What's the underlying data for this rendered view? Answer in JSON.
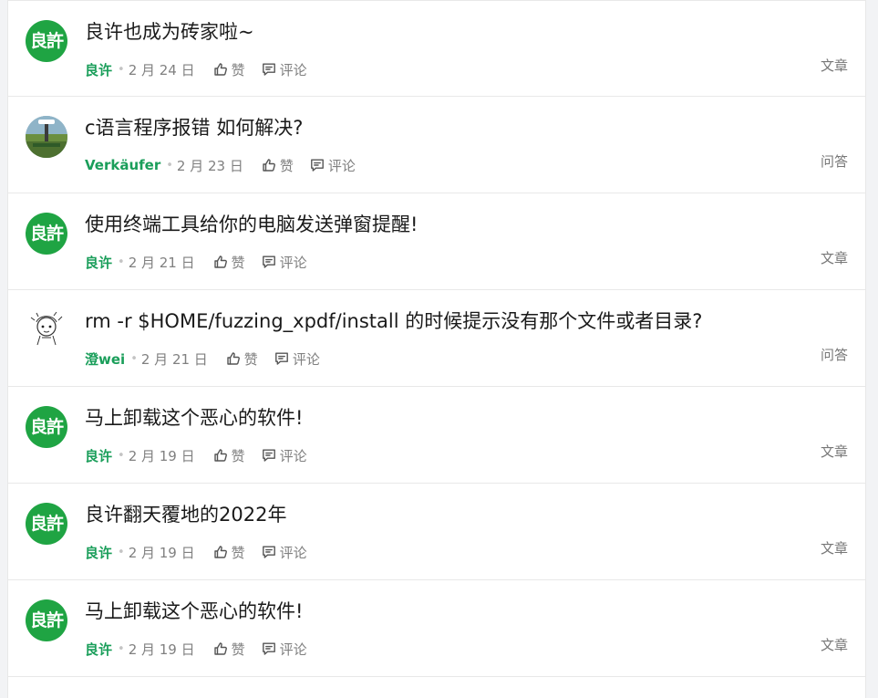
{
  "feed": {
    "items": [
      {
        "avatar": "lx",
        "avatar_text": "良許",
        "title": "良许也成为砖家啦~",
        "author": "良许",
        "date": "2 月 24 日",
        "like_label": "赞",
        "comment_label": "评论",
        "type": "文章"
      },
      {
        "avatar": "photo",
        "avatar_text": "",
        "title": "c语言程序报错 如何解决?",
        "author": "Verkäufer",
        "date": "2 月 23 日",
        "like_label": "赞",
        "comment_label": "评论",
        "type": "问答"
      },
      {
        "avatar": "lx",
        "avatar_text": "良許",
        "title": "使用终端工具给你的电脑发送弹窗提醒!",
        "author": "良许",
        "date": "2 月 21 日",
        "like_label": "赞",
        "comment_label": "评论",
        "type": "文章"
      },
      {
        "avatar": "sketch",
        "avatar_text": "",
        "title": "rm -r $HOME/fuzzing_xpdf/install 的时候提示没有那个文件或者目录?",
        "author": "澄wei",
        "date": "2 月 21 日",
        "like_label": "赞",
        "comment_label": "评论",
        "type": "问答"
      },
      {
        "avatar": "lx",
        "avatar_text": "良許",
        "title": "马上卸载这个恶心的软件!",
        "author": "良许",
        "date": "2 月 19 日",
        "like_label": "赞",
        "comment_label": "评论",
        "type": "文章"
      },
      {
        "avatar": "lx",
        "avatar_text": "良許",
        "title": "良许翻天覆地的2022年",
        "author": "良许",
        "date": "2 月 19 日",
        "like_label": "赞",
        "comment_label": "评论",
        "type": "文章"
      },
      {
        "avatar": "lx",
        "avatar_text": "良許",
        "title": "马上卸载这个恶心的软件!",
        "author": "良许",
        "date": "2 月 19 日",
        "like_label": "赞",
        "comment_label": "评论",
        "type": "文章"
      }
    ]
  },
  "colors": {
    "author": "#1a9e5a",
    "avatar_green": "#1fa443",
    "meta_gray": "#808080"
  },
  "icons": {
    "like": "thumbs-up-icon",
    "comment": "comment-icon"
  }
}
